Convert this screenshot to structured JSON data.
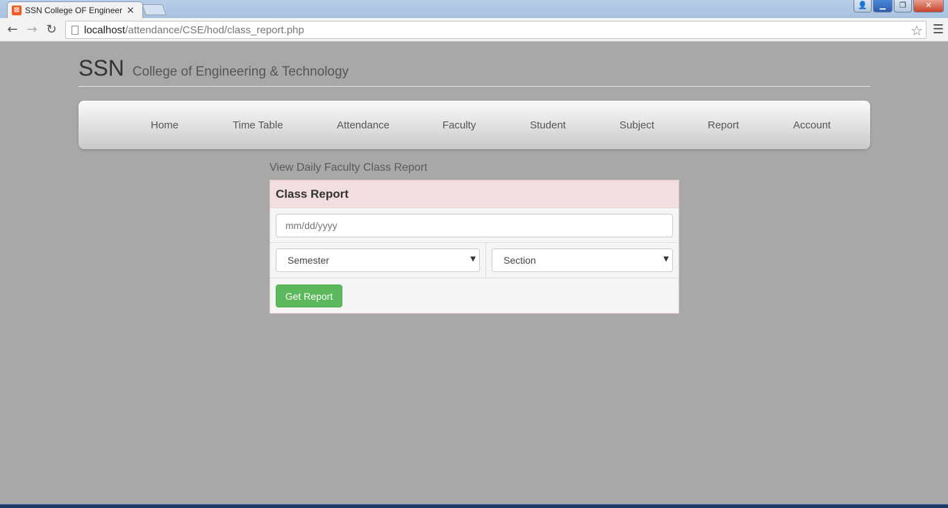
{
  "browser": {
    "tab_title": "SSN College OF Engineeri",
    "url_host": "localhost",
    "url_path": "/attendance/CSE/hod/class_report.php"
  },
  "site": {
    "brand": "SSN",
    "subtitle": "College of Engineering & Technology"
  },
  "nav": {
    "home": "Home",
    "timetable": "Time Table",
    "attendance": "Attendance",
    "faculty": "Faculty",
    "student": "Student",
    "subject": "Subject",
    "report": "Report",
    "account": "Account"
  },
  "page": {
    "heading": "View Daily Faculty Class Report"
  },
  "panel": {
    "title": "Class Report",
    "date_placeholder": "mm/dd/yyyy",
    "semester_select": "Semester",
    "section_select": "Section",
    "submit_label": "Get Report"
  },
  "colors": {
    "page_bg": "#a8a8a8",
    "panel_header_bg": "#f2dede",
    "button_green": "#5cb85c"
  }
}
